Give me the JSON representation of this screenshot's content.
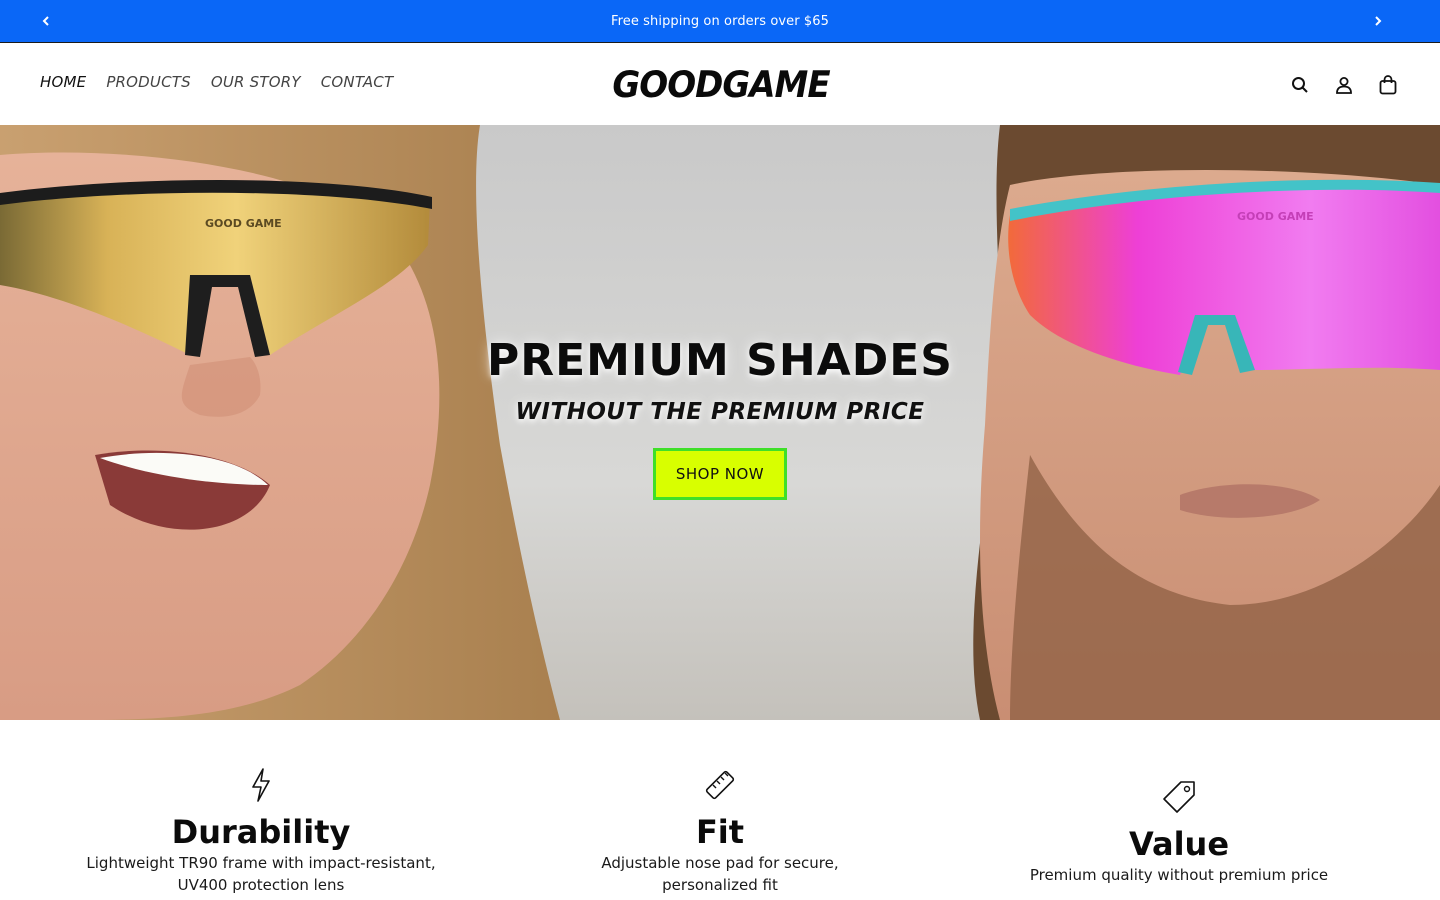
{
  "announcement": {
    "message": "Free shipping on orders over $65",
    "prev_icon": "chevron-left-icon",
    "next_icon": "chevron-right-icon"
  },
  "header": {
    "logo_text": "GOODGAME",
    "nav": [
      {
        "label": "HOME",
        "active": true
      },
      {
        "label": "PRODUCTS",
        "active": false
      },
      {
        "label": "OUR STORY",
        "active": false
      },
      {
        "label": "CONTACT",
        "active": false
      }
    ],
    "icons": [
      "search-icon",
      "account-icon",
      "cart-icon"
    ]
  },
  "hero": {
    "title": "PREMIUM SHADES",
    "subtitle": "WITHOUT THE PREMIUM PRICE",
    "cta_label": "SHOP NOW",
    "lens_brand": "GOOD GAME",
    "colors": {
      "cta_bg": "#d8ff00",
      "cta_border": "#3fdf29",
      "left_lens": "#d9a848",
      "right_lens": "#ee3fd6"
    }
  },
  "features": [
    {
      "icon": "lightning-icon",
      "title": "Durability",
      "lines": [
        "Lightweight TR90 frame with impact-resistant,",
        "UV400 protection lens"
      ]
    },
    {
      "icon": "ruler-icon",
      "title": "Fit",
      "lines": [
        "Adjustable nose pad for secure,",
        "personalized fit"
      ]
    },
    {
      "icon": "price-tag-icon",
      "title": "Value",
      "lines": [
        "Premium quality without premium price"
      ]
    }
  ],
  "colors": {
    "announcement_bg": "#0a67f7"
  }
}
